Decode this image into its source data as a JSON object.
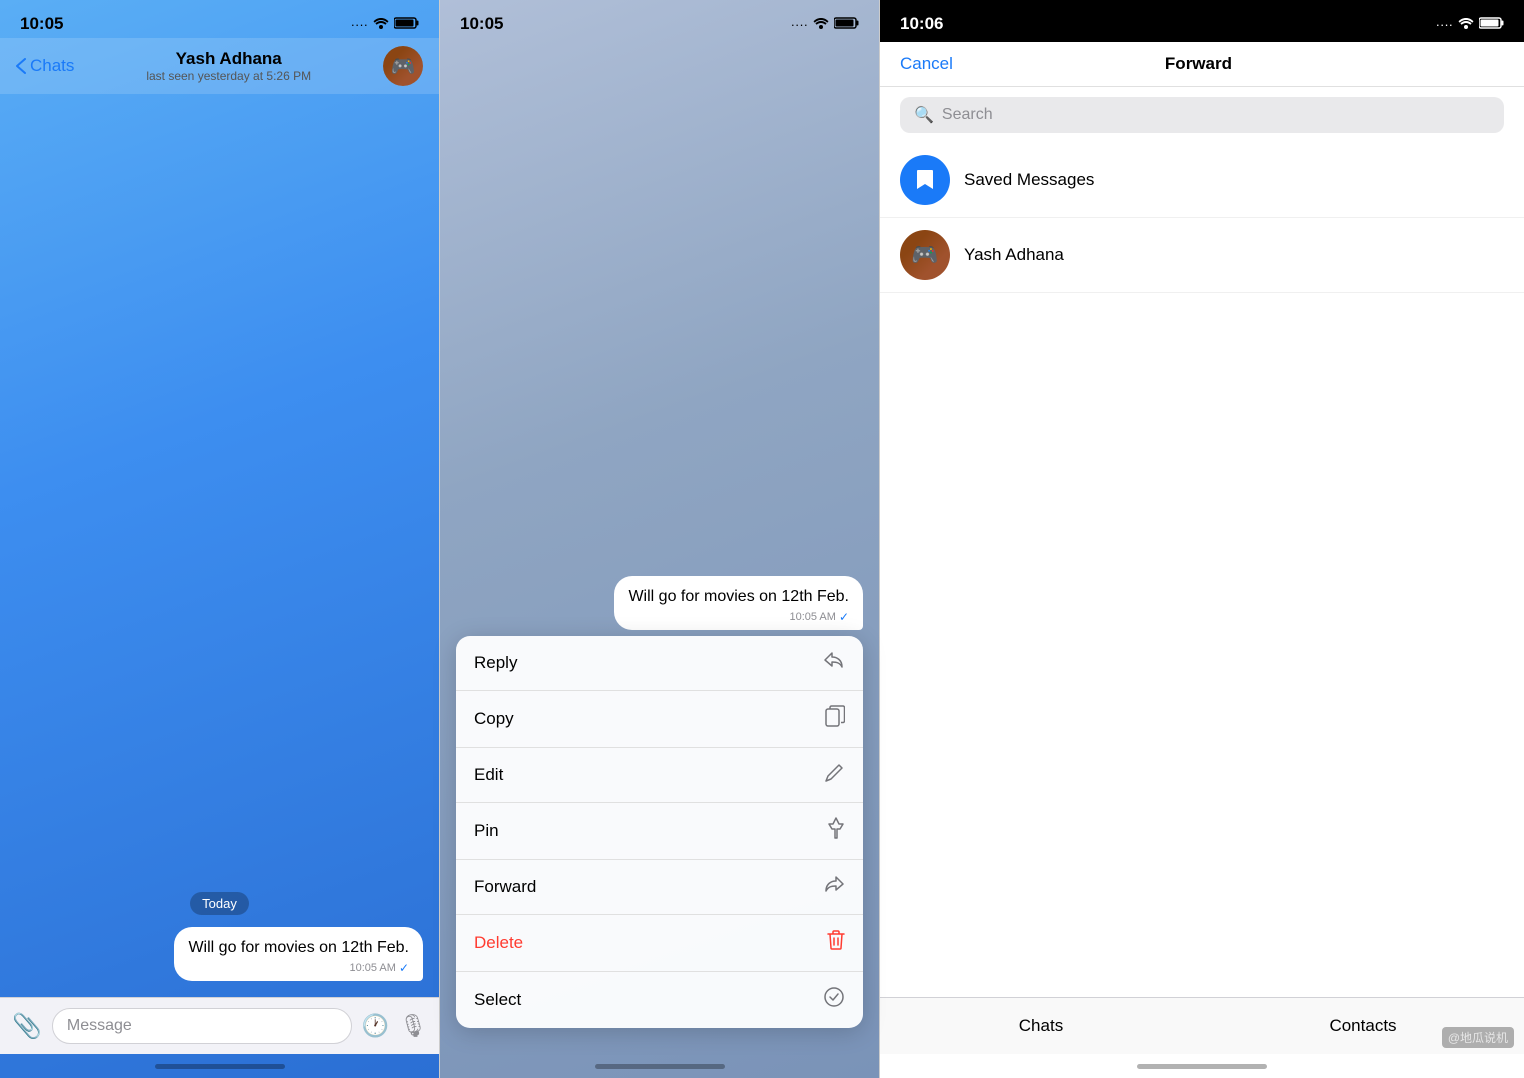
{
  "panel1": {
    "status_time": "10:05",
    "status_signal": "····",
    "status_wifi": "WiFi",
    "status_battery": "🔋",
    "nav_back": "Chats",
    "contact_name": "Yash Adhana",
    "contact_status": "last seen yesterday at 5:26 PM",
    "date_badge": "Today",
    "message_text": "Will go for movies on 12th Feb.",
    "message_time": "10:05 AM",
    "input_placeholder": "Message"
  },
  "panel2": {
    "status_time": "10:05",
    "message_text": "Will go for movies on 12th Feb.",
    "message_time": "10:05 AM",
    "menu_items": [
      {
        "label": "Reply",
        "icon": "↩",
        "is_delete": false
      },
      {
        "label": "Copy",
        "icon": "⧉",
        "is_delete": false
      },
      {
        "label": "Edit",
        "icon": "✏",
        "is_delete": false
      },
      {
        "label": "Pin",
        "icon": "📌",
        "is_delete": false
      },
      {
        "label": "Forward",
        "icon": "↪",
        "is_delete": false
      },
      {
        "label": "Delete",
        "icon": "🗑",
        "is_delete": true
      },
      {
        "label": "Select",
        "icon": "✓",
        "is_delete": false
      }
    ]
  },
  "panel3": {
    "status_time": "10:06",
    "cancel_label": "Cancel",
    "title": "Forward",
    "search_placeholder": "Search",
    "contacts": [
      {
        "name": "Saved Messages",
        "type": "saved"
      },
      {
        "name": "Yash Adhana",
        "type": "yash"
      }
    ],
    "bottom_tabs": [
      {
        "label": "Chats"
      },
      {
        "label": "Contacts"
      }
    ],
    "watermark": "@地瓜说机"
  }
}
